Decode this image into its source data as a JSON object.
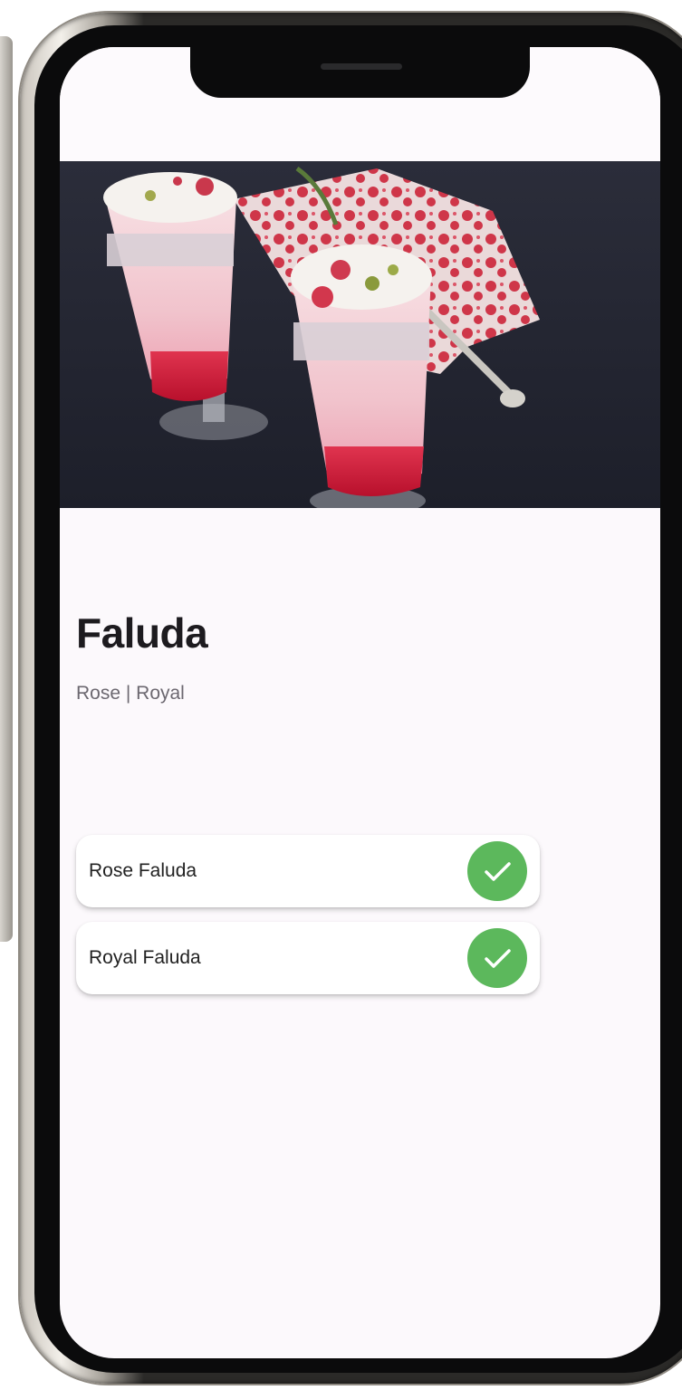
{
  "product": {
    "title": "Faluda",
    "subtitle": "Rose | Royal"
  },
  "options": [
    {
      "label": "Rose Faluda",
      "selected": true
    },
    {
      "label": "Royal Faluda",
      "selected": true
    }
  ],
  "colors": {
    "check": "#5cb85c",
    "title": "#1d1b1f",
    "subtitle": "#6c6870",
    "screen_bg": "#fcf9fc"
  },
  "icons": {
    "check": "checkmark-circle-icon"
  }
}
